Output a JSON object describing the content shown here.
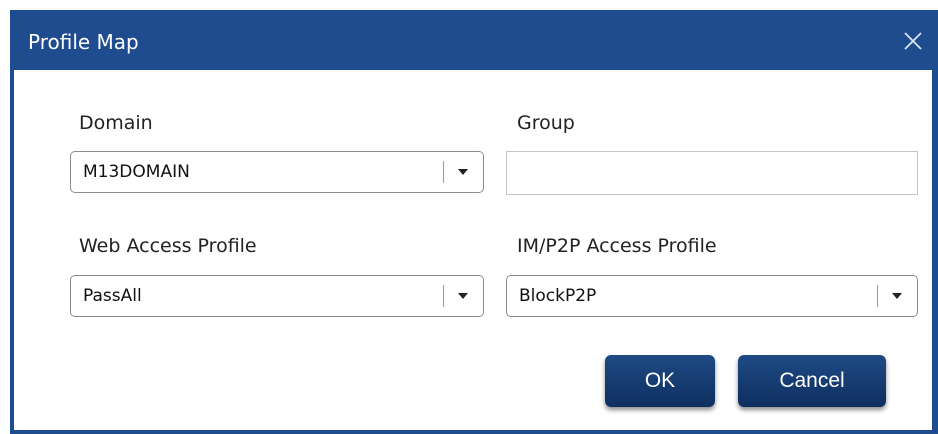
{
  "dialog": {
    "title": "Profile Map",
    "close_icon": "close-icon",
    "colors": {
      "titlebar": "#1e4c8f",
      "button": "#163a6e",
      "body": "#ffffff"
    }
  },
  "fields": {
    "domain": {
      "label": "Domain",
      "value": "M13DOMAIN"
    },
    "group": {
      "label": "Group",
      "value": ""
    },
    "web_access_profile": {
      "label": "Web Access Profile",
      "value": "PassAll"
    },
    "im_p2p_access_profile": {
      "label": "IM/P2P Access Profile",
      "value": "BlockP2P"
    }
  },
  "buttons": {
    "ok": "OK",
    "cancel": "Cancel"
  }
}
